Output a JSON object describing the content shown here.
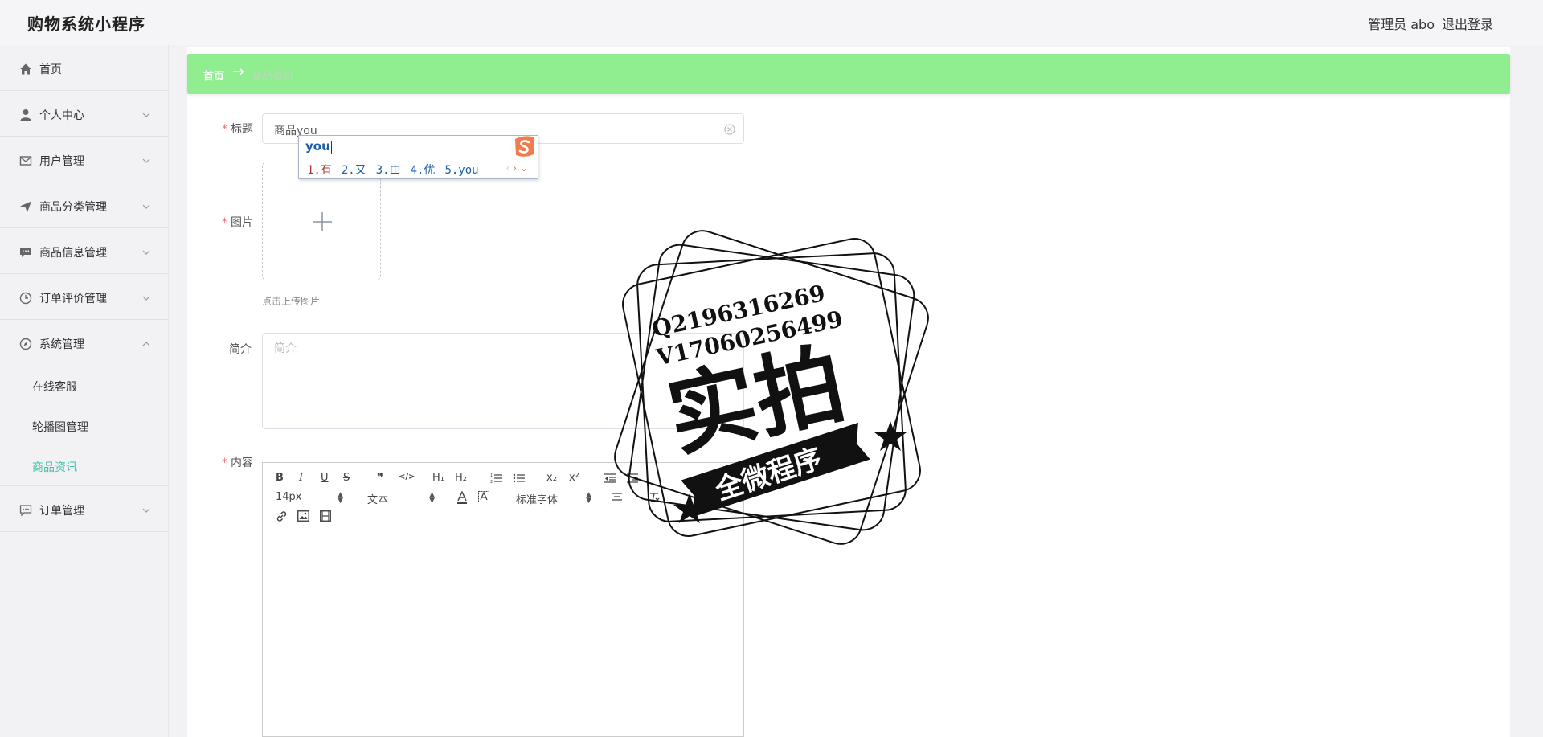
{
  "header": {
    "brand": "购物系统小程序",
    "admin": "管理员 abo",
    "logout": "退出登录"
  },
  "sidebar": {
    "items": [
      {
        "label": "首页",
        "icon": "home-icon"
      },
      {
        "label": "个人中心",
        "icon": "user-icon"
      },
      {
        "label": "用户管理",
        "icon": "mail-icon"
      },
      {
        "label": "商品分类管理",
        "icon": "send-icon"
      },
      {
        "label": "商品信息管理",
        "icon": "chat-icon"
      },
      {
        "label": "订单评价管理",
        "icon": "clock-icon"
      },
      {
        "label": "系统管理",
        "icon": "compass-icon"
      }
    ],
    "sub_items": [
      "在线客服",
      "轮播图管理",
      "商品资讯"
    ],
    "last_item": {
      "label": "订单管理",
      "icon": "message-icon"
    }
  },
  "breadcrumb": {
    "home": "首页",
    "arrow": "→",
    "current": "商品资讯"
  },
  "form": {
    "title_label": "标题",
    "title_value": "商品you",
    "image_label": "图片",
    "upload_tip": "点击上传图片",
    "intro_label": "简介",
    "intro_placeholder": "简介",
    "content_label": "内容"
  },
  "ime": {
    "composition": "you",
    "candidates": [
      "1.有",
      "2.又",
      "3.由",
      "4.优",
      "5.you"
    ]
  },
  "editor": {
    "buttons": {
      "bold": "B",
      "italic": "I",
      "underline": "U",
      "strike": "S",
      "quote": "❞",
      "code": "</>",
      "h1": "H₁",
      "h2": "H₂",
      "sub": "x₂",
      "sup": "x²"
    },
    "size": "14px",
    "block": "文本",
    "font": "标准字体"
  },
  "watermark": {
    "line1": "Q2196316269",
    "line2": "V17060256499",
    "main": "实拍",
    "ribbon": "全微程序"
  },
  "colors": {
    "accent": "#3fbfa8",
    "breadcrumb_bg": "#90ee90",
    "required": "#f56c6c",
    "ime_blue": "#1c5fa8"
  }
}
